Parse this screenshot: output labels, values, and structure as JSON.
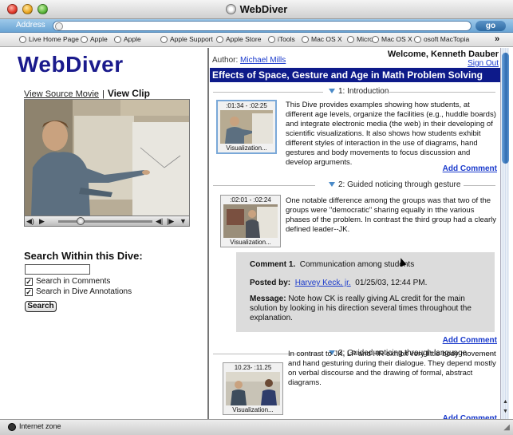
{
  "window": {
    "title": "WebDiver"
  },
  "address": {
    "label": "Address",
    "go": "go",
    "value": ""
  },
  "favorites": [
    {
      "label": "Live Home Page"
    },
    {
      "label": "Apple"
    },
    {
      "label": "Apple"
    },
    {
      "label": "Apple Support"
    },
    {
      "label": "Apple Store"
    },
    {
      "label": "iTools"
    },
    {
      "label": "Mac OS X"
    },
    {
      "label": "Micro"
    },
    {
      "label": "Mac OS X"
    },
    {
      "label": "osoft MacTopia"
    }
  ],
  "left": {
    "logo": "WebDiver",
    "view_source": "View Source Movie",
    "separator": "|",
    "view_clip": "View Clip",
    "search_title": "Search Within this Dive:",
    "search_value": "",
    "opt_comments": "Search in Comments",
    "opt_annotations": "Search in Dive Annotations",
    "search_button": "Search",
    "checkmark": "✓"
  },
  "right": {
    "author_label": "Author:",
    "author_name": "Michael Mills",
    "welcome": "Welcome, Kenneth Dauber",
    "sign_out": "Sign Out",
    "dive_title": "Effects of Space, Gesture and Age in Math Problem Solving",
    "add_comment": "Add Comment",
    "sections": [
      {
        "heading": "1: Introduction",
        "time": ":01:34 - :02:25",
        "caption": "Visualization...",
        "text": "This Dive provides examples showing how students, at different age levels, organize the facilities (e.g., huddle boards) and integrate electronic media (the web) in their developing of scientific visualizations. It also shows how students exhibit different styles of interaction in the use of diagrams, hand gestures and body movements to focus discussion and develop arguments."
      },
      {
        "heading": "2: Guided noticing through gesture",
        "time": ":02:01 - :02:24",
        "caption": "Visualization...",
        "text": "One notable difference among the groups was that two of the groups were \"democratic\"  sharing equally in tthe various phases of the problem. In contrast  the third group  had a clearly defined leader--JK."
      },
      {
        "heading": "3: Guided noticing through language",
        "time": "10.23- :11.25",
        "caption": "Visualization...",
        "text": "In contrast to JK, LP and HR exhibit very little  body movement and hand gesturing during their dialogue. They depend mostly on verbal discourse and the drawing of formal, abstract diagrams."
      }
    ],
    "comment": {
      "label": "Comment 1.",
      "subject": "Communication among students",
      "posted_label": "Posted by:",
      "posted_name": "Harvey Keck, jr.",
      "posted_date": "01/25/03, 12:44 PM.",
      "message_label": "Message:",
      "message": "Note how CK is really giving AL credit for the main solution by looking in his direction several times throughout the explanation."
    }
  },
  "status": {
    "text": "Internet zone"
  }
}
